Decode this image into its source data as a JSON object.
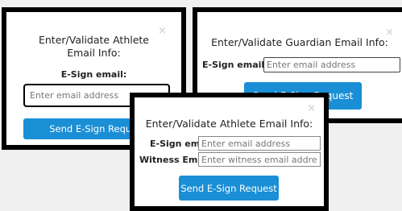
{
  "dialogs": {
    "athlete_simple": {
      "close_glyph": "×",
      "title": "Enter/Validate Athlete Email Info:",
      "email_label": "E-Sign email:",
      "email_placeholder": "Enter email address",
      "button_label": "Send E-Sign Request"
    },
    "guardian": {
      "close_glyph": "×",
      "title": "Enter/Validate Guardian Email Info:",
      "email_label": "E-Sign email:",
      "email_placeholder": "Enter email address",
      "button_label": "Send E-Sign Request"
    },
    "athlete_witness": {
      "close_glyph": "×",
      "title": "Enter/Validate Athlete Email Info:",
      "email_label": "E-Sign email:",
      "email_placeholder": "Enter email address",
      "witness_label": "Witness Email:",
      "witness_placeholder": "Enter witness email address",
      "button_label": "Send E-Sign Request"
    }
  },
  "colors": {
    "background": "#f0f0f0",
    "panel_border": "#000000",
    "button": "#1a8fd6",
    "close_icon": "#d9d9d9"
  }
}
